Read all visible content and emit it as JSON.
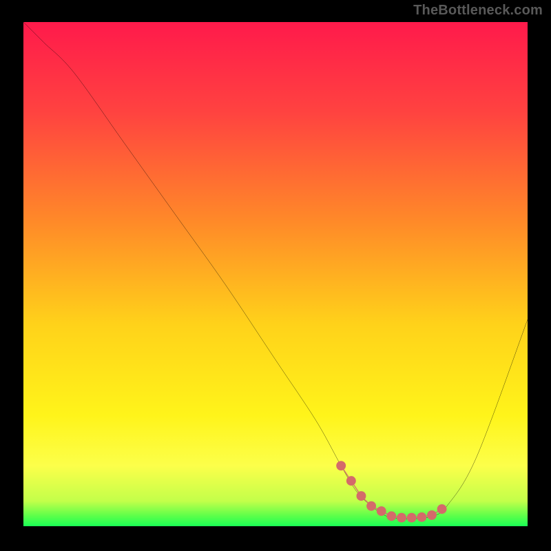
{
  "watermark": "TheBottleneck.com",
  "chart_data": {
    "type": "line",
    "title": "",
    "xlabel": "",
    "ylabel": "",
    "xlim": [
      0,
      100
    ],
    "ylim": [
      0,
      100
    ],
    "grid": false,
    "legend": false,
    "annotations": [],
    "gradient_stops": [
      {
        "offset": 0,
        "color": "#ff1a4b"
      },
      {
        "offset": 18,
        "color": "#ff4340"
      },
      {
        "offset": 40,
        "color": "#ff8b28"
      },
      {
        "offset": 60,
        "color": "#ffd21a"
      },
      {
        "offset": 78,
        "color": "#fff41a"
      },
      {
        "offset": 88,
        "color": "#fcff4a"
      },
      {
        "offset": 95,
        "color": "#c3ff4a"
      },
      {
        "offset": 98,
        "color": "#5bff4a"
      },
      {
        "offset": 100,
        "color": "#1aff55"
      }
    ],
    "series": [
      {
        "name": "bottleneck-curve",
        "color": "#000000",
        "x": [
          0,
          4,
          10,
          20,
          30,
          40,
          50,
          58,
          63,
          66,
          69,
          72,
          75,
          78,
          81,
          84,
          90,
          100
        ],
        "y": [
          100,
          96,
          90,
          76,
          62,
          48,
          33,
          21,
          12,
          7,
          4,
          2,
          1.5,
          1.5,
          2,
          4,
          14,
          41
        ]
      }
    ],
    "highlight": {
      "name": "optimal-range",
      "color": "#d46a6a",
      "points_x": [
        63,
        65,
        67,
        69,
        71,
        73,
        75,
        77,
        79,
        81,
        83
      ],
      "points_y": [
        12,
        9,
        6,
        4,
        3,
        2,
        1.7,
        1.7,
        1.8,
        2.2,
        3.4
      ]
    }
  }
}
